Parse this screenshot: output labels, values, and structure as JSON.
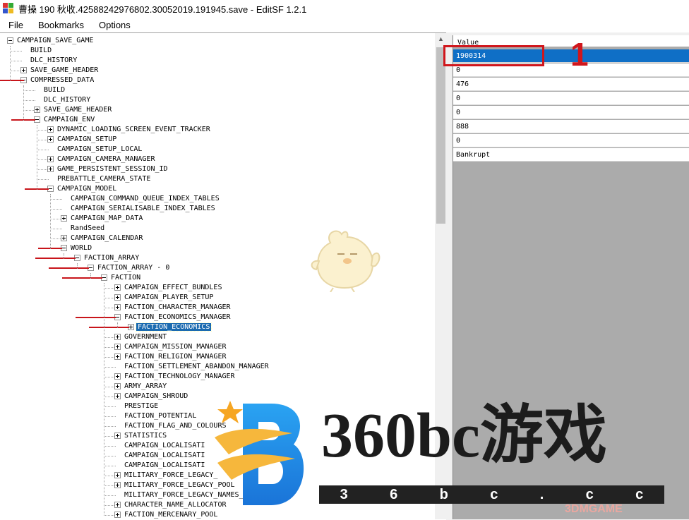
{
  "window": {
    "title": "曹操 190 秋收.42588242976802.30052019.191945.save - EditSF 1.2.1"
  },
  "menu": [
    "File",
    "Bookmarks",
    "Options"
  ],
  "tree": [
    {
      "label": "CAMPAIGN_SAVE_GAME",
      "level": 0,
      "expander": "minus"
    },
    {
      "label": "BUILD",
      "level": 1,
      "expander": "none"
    },
    {
      "label": "DLC_HISTORY",
      "level": 1,
      "expander": "none"
    },
    {
      "label": "SAVE_GAME_HEADER",
      "level": 1,
      "expander": "plus"
    },
    {
      "label": "COMPRESSED_DATA",
      "level": 1,
      "expander": "minus"
    },
    {
      "label": "BUILD",
      "level": 2,
      "expander": "none"
    },
    {
      "label": "DLC_HISTORY",
      "level": 2,
      "expander": "none"
    },
    {
      "label": "SAVE_GAME_HEADER",
      "level": 2,
      "expander": "plus"
    },
    {
      "label": "CAMPAIGN_ENV",
      "level": 2,
      "expander": "minus"
    },
    {
      "label": "DYNAMIC_LOADING_SCREEN_EVENT_TRACKER",
      "level": 3,
      "expander": "plus"
    },
    {
      "label": "CAMPAIGN_SETUP",
      "level": 3,
      "expander": "plus"
    },
    {
      "label": "CAMPAIGN_SETUP_LOCAL",
      "level": 3,
      "expander": "none"
    },
    {
      "label": "CAMPAIGN_CAMERA_MANAGER",
      "level": 3,
      "expander": "plus"
    },
    {
      "label": "GAME_PERSISTENT_SESSION_ID",
      "level": 3,
      "expander": "plus"
    },
    {
      "label": "PREBATTLE_CAMERA_STATE",
      "level": 3,
      "expander": "none"
    },
    {
      "label": "CAMPAIGN_MODEL",
      "level": 3,
      "expander": "minus"
    },
    {
      "label": "CAMPAIGN_COMMAND_QUEUE_INDEX_TABLES",
      "level": 4,
      "expander": "none"
    },
    {
      "label": "CAMPAIGN_SERIALISABLE_INDEX_TABLES",
      "level": 4,
      "expander": "none"
    },
    {
      "label": "CAMPAIGN_MAP_DATA",
      "level": 4,
      "expander": "plus"
    },
    {
      "label": "RandSeed",
      "level": 4,
      "expander": "none"
    },
    {
      "label": "CAMPAIGN_CALENDAR",
      "level": 4,
      "expander": "plus"
    },
    {
      "label": "WORLD",
      "level": 4,
      "expander": "minus"
    },
    {
      "label": "FACTION_ARRAY",
      "level": 5,
      "expander": "minus"
    },
    {
      "label": "FACTION_ARRAY - 0",
      "level": 6,
      "expander": "minus"
    },
    {
      "label": "FACTION",
      "level": 7,
      "expander": "minus"
    },
    {
      "label": "CAMPAIGN_EFFECT_BUNDLES",
      "level": 8,
      "expander": "plus"
    },
    {
      "label": "CAMPAIGN_PLAYER_SETUP",
      "level": 8,
      "expander": "plus"
    },
    {
      "label": "FACTION_CHARACTER_MANAGER",
      "level": 8,
      "expander": "plus"
    },
    {
      "label": "FACTION_ECONOMICS_MANAGER",
      "level": 8,
      "expander": "minus"
    },
    {
      "label": "FACTION_ECONOMICS",
      "level": 9,
      "expander": "plus",
      "selected": true
    },
    {
      "label": "GOVERNMENT",
      "level": 8,
      "expander": "plus"
    },
    {
      "label": "CAMPAIGN_MISSION_MANAGER",
      "level": 8,
      "expander": "plus"
    },
    {
      "label": "FACTION_RELIGION_MANAGER",
      "level": 8,
      "expander": "plus"
    },
    {
      "label": "FACTION_SETTLEMENT_ABANDON_MANAGER",
      "level": 8,
      "expander": "none"
    },
    {
      "label": "FACTION_TECHNOLOGY_MANAGER",
      "level": 8,
      "expander": "plus"
    },
    {
      "label": "ARMY_ARRAY",
      "level": 8,
      "expander": "plus"
    },
    {
      "label": "CAMPAIGN_SHROUD",
      "level": 8,
      "expander": "plus"
    },
    {
      "label": "PRESTIGE",
      "level": 8,
      "expander": "none"
    },
    {
      "label": "FACTION_POTENTIAL",
      "level": 8,
      "expander": "none"
    },
    {
      "label": "FACTION_FLAG_AND_COLOURS",
      "level": 8,
      "expander": "none"
    },
    {
      "label": "STATISTICS",
      "level": 8,
      "expander": "plus"
    },
    {
      "label": "CAMPAIGN_LOCALISATI",
      "level": 8,
      "expander": "none"
    },
    {
      "label": "CAMPAIGN_LOCALISATI",
      "level": 8,
      "expander": "none"
    },
    {
      "label": "CAMPAIGN_LOCALISATI",
      "level": 8,
      "expander": "none"
    },
    {
      "label": "MILITARY_FORCE_LEGACY_",
      "level": 8,
      "expander": "plus"
    },
    {
      "label": "MILITARY_FORCE_LEGACY_POOL",
      "level": 8,
      "expander": "plus"
    },
    {
      "label": "MILITARY_FORCE_LEGACY_NAMES_",
      "level": 8,
      "expander": "none"
    },
    {
      "label": "CHARACTER_NAME_ALLOCATOR",
      "level": 8,
      "expander": "plus"
    },
    {
      "label": "FACTION_MERCENARY_POOL",
      "level": 8,
      "expander": "plus"
    }
  ],
  "grid": {
    "header": "Value",
    "rows": [
      "1900314",
      "0",
      "476",
      "0",
      "0",
      "888",
      "0",
      "Bankrupt"
    ]
  },
  "annotation": {
    "number": "1"
  },
  "watermark": {
    "main": "360bc游戏",
    "bar": [
      "3",
      "6",
      "b",
      "c",
      ".",
      "c",
      "c"
    ],
    "small": "3DMGAME"
  }
}
